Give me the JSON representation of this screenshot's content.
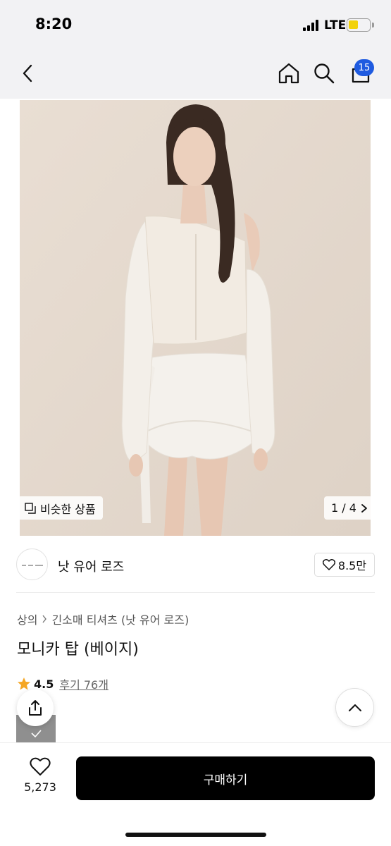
{
  "status_bar": {
    "time": "8:20",
    "network": "LTE"
  },
  "top_nav": {
    "back_icon": "chevron-left-icon",
    "home_icon": "home-icon",
    "search_icon": "search-icon",
    "cart_icon": "shopping-bag-icon",
    "cart_count": "15"
  },
  "hero": {
    "similar_label": "비슷한 상품",
    "page_indicator": "1 / 4"
  },
  "brand": {
    "name": "낫 유어 로즈",
    "likes": "8.5만"
  },
  "product": {
    "breadcrumb": [
      "상의",
      "긴소매 티셔츠 (낫 유어 로즈)"
    ],
    "title": "모니카 탑 (베이지)",
    "rating": "4.5",
    "reviews": "후기 76개"
  },
  "bottom_bar": {
    "wishlist_count": "5,273",
    "buy_label": "구매하기"
  },
  "colors": {
    "badge": "#1f5be0",
    "star": "#f5a623",
    "buy_button": "#000000",
    "nav_bg": "#f2f2f4"
  }
}
